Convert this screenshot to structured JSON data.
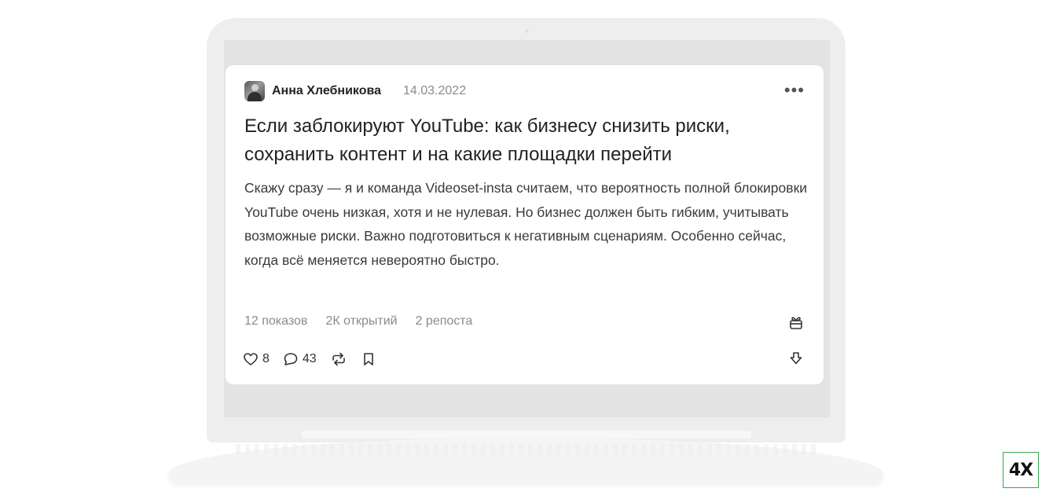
{
  "post": {
    "author": "Анна Хлебникова",
    "date": "14.03.2022",
    "more_icon": "•••",
    "title": "Если заблокируют YouTube: как бизнесу снизить риски, сохранить контент и на какие площадки перейти",
    "body": "Скажу сразу — я и команда Videoset-insta считаем, что вероятность полной блокировки YouTube очень низкая, хотя и не нулевая. Но бизнес должен быть гибким, учитывать возможные риски. Важно подготовиться к негативным сценариям. Особенно сейчас, когда всё меняется невероятно быстро.",
    "stats": {
      "views": "12 показов",
      "opens": "2К открытий",
      "reposts": "2 репоста"
    },
    "actions": {
      "likes": "8",
      "comments": "43"
    }
  },
  "badge": "4X",
  "icons": [
    "heart-icon",
    "comment-icon",
    "repost-icon",
    "bookmark-icon",
    "gift-icon",
    "download-icon",
    "more-icon"
  ]
}
